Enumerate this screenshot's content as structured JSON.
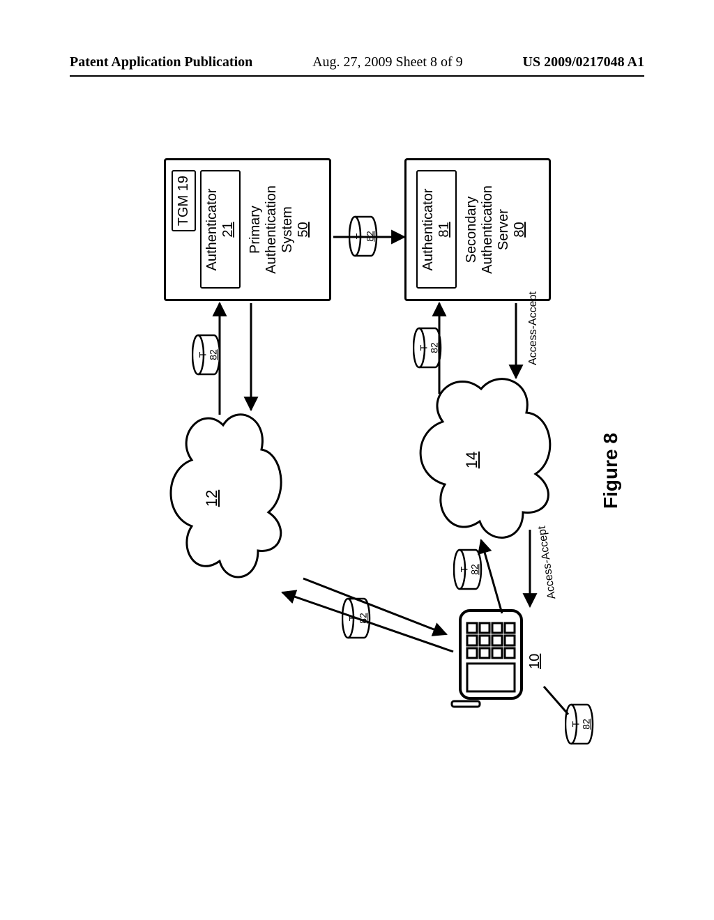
{
  "header": {
    "left": "Patent Application Publication",
    "center": "Aug. 27, 2009  Sheet 8 of 9",
    "right": "US 2009/0217048 A1"
  },
  "figure_label": "Figure 8",
  "clouds": {
    "c12": "12",
    "c14": "14"
  },
  "phone": {
    "ref": "10"
  },
  "token": {
    "letter": "T",
    "ref": "82"
  },
  "primary_box": {
    "tgm": "TGM 19",
    "auth_label": "Authenticator",
    "auth_ref": "21",
    "title_line1": "Primary",
    "title_line2": "Authentication",
    "title_line3": "System",
    "ref": "50"
  },
  "secondary_box": {
    "auth_label": "Authenticator",
    "auth_ref": "81",
    "title_line1": "Secondary",
    "title_line2": "Authentication",
    "title_line3": "Server",
    "ref": "80"
  },
  "edges": {
    "access_accept_right": "Access-Accept",
    "access_accept_left": "Access-Accept"
  }
}
